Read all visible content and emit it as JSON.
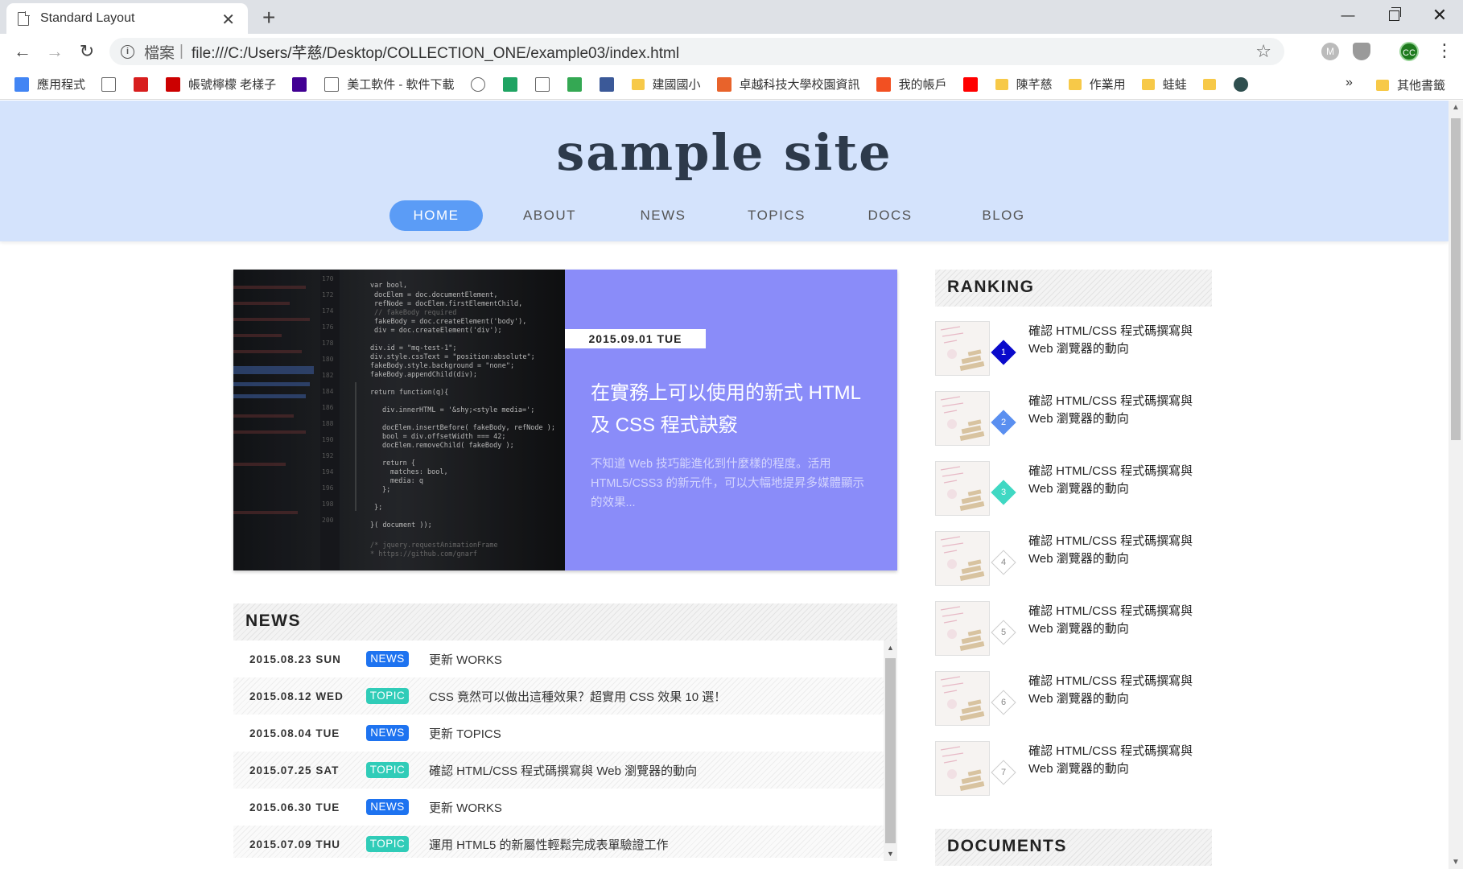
{
  "browser": {
    "tab_title": "Standard Layout",
    "new_tab": "+",
    "scheme_label": "檔案",
    "separator": "|",
    "url": "file:///C:/Users/芊慈/Desktop/COLLECTION_ONE/example03/index.html",
    "avatar_initials": "CC",
    "bookmarks": [
      {
        "label": "應用程式",
        "icon": "apps-grid-icon"
      },
      {
        "label": "",
        "icon": "page-icon"
      },
      {
        "label": "",
        "icon": "red-logo-icon"
      },
      {
        "label": "帳號檸檬 老樣子",
        "icon": "red-badge-icon"
      },
      {
        "label": "",
        "icon": "yahoo-icon"
      },
      {
        "label": "美工軟件 - 軟件下載",
        "icon": "e-icon"
      },
      {
        "label": "",
        "icon": "google-icon"
      },
      {
        "label": "",
        "icon": "drive-icon"
      },
      {
        "label": "",
        "icon": "gmail-icon"
      },
      {
        "label": "",
        "icon": "maps-icon"
      },
      {
        "label": "",
        "icon": "facebook-icon"
      },
      {
        "label": "建國國小",
        "icon": "folder-icon"
      },
      {
        "label": "卓越科技大學校園資訊",
        "icon": "school-icon"
      },
      {
        "label": "我的帳戶",
        "icon": "microsoft-icon"
      },
      {
        "label": "",
        "icon": "youtube-icon"
      },
      {
        "label": "陳芊慈",
        "icon": "folder-icon"
      },
      {
        "label": "作業用",
        "icon": "folder-icon"
      },
      {
        "label": "蛙蛙",
        "icon": "folder-icon"
      },
      {
        "label": "",
        "icon": "folder-icon"
      },
      {
        "label": "",
        "icon": "circle-icon"
      }
    ],
    "bookmarks_more": "»",
    "other_bookmarks": "其他書籤"
  },
  "site": {
    "logo": "sample site",
    "nav": [
      "HOME",
      "ABOUT",
      "NEWS",
      "TOPICS",
      "DOCS",
      "BLOG"
    ],
    "active_nav": "HOME"
  },
  "hero": {
    "date": "2015.09.01 TUE",
    "title": "在實務上可以使用的新式 HTML 及 CSS 程式訣竅",
    "description": "不知道 Web 技巧能進化到什麼樣的程度。活用 HTML5/CSS3 的新元件，可以大幅地提昇多媒體顯示的效果..."
  },
  "news": {
    "heading": "NEWS",
    "items": [
      {
        "date": "2015.08.23 SUN",
        "tag": "NEWS",
        "text": "更新 WORKS"
      },
      {
        "date": "2015.08.12 WED",
        "tag": "TOPIC",
        "text": "CSS 竟然可以做出這種效果？超實用 CSS 效果 10 選！"
      },
      {
        "date": "2015.08.04 TUE",
        "tag": "NEWS",
        "text": "更新 TOPICS"
      },
      {
        "date": "2015.07.25 SAT",
        "tag": "TOPIC",
        "text": "確認 HTML/CSS 程式碼撰寫與 Web 瀏覽器的動向"
      },
      {
        "date": "2015.06.30 TUE",
        "tag": "NEWS",
        "text": "更新 WORKS"
      },
      {
        "date": "2015.07.09 THU",
        "tag": "TOPIC",
        "text": "運用 HTML5 的新屬性輕鬆完成表單驗證工作"
      }
    ]
  },
  "ranking": {
    "heading": "RANKING",
    "items": [
      {
        "rank": "1",
        "text": "確認 HTML/CSS 程式碼撰寫與 Web 瀏覽器的動向"
      },
      {
        "rank": "2",
        "text": "確認 HTML/CSS 程式碼撰寫與 Web 瀏覽器的動向"
      },
      {
        "rank": "3",
        "text": "確認 HTML/CSS 程式碼撰寫與 Web 瀏覽器的動向"
      },
      {
        "rank": "4",
        "text": "確認 HTML/CSS 程式碼撰寫與 Web 瀏覽器的動向"
      },
      {
        "rank": "5",
        "text": "確認 HTML/CSS 程式碼撰寫與 Web 瀏覽器的動向"
      },
      {
        "rank": "6",
        "text": "確認 HTML/CSS 程式碼撰寫與 Web 瀏覽器的動向"
      },
      {
        "rank": "7",
        "text": "確認 HTML/CSS 程式碼撰寫與 Web 瀏覽器的動向"
      }
    ]
  },
  "documents": {
    "heading": "DOCUMENTS"
  },
  "colors": {
    "header_bg": "#d4e3fc",
    "nav_active": "#5b9cf6",
    "hero_panel": "#8a8cf9",
    "news_badge": "#1e73f0",
    "topic_badge": "#30ccb8"
  }
}
